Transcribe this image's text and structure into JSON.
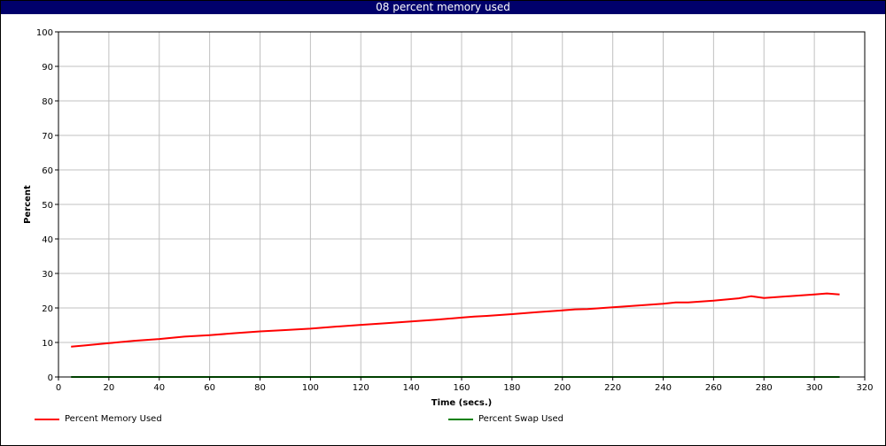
{
  "window": {
    "title": "08 percent memory used"
  },
  "chart_data": {
    "type": "line",
    "title": "08 percent memory used",
    "xlabel": "Time (secs.)",
    "ylabel": "Percent",
    "xlim": [
      0,
      320
    ],
    "ylim": [
      0,
      100
    ],
    "xticks": [
      0,
      20,
      40,
      60,
      80,
      100,
      120,
      140,
      160,
      180,
      200,
      220,
      240,
      260,
      280,
      300,
      320
    ],
    "yticks": [
      0,
      10,
      20,
      30,
      40,
      50,
      60,
      70,
      80,
      90,
      100
    ],
    "grid": true,
    "legend_position": "bottom",
    "series": [
      {
        "name": "Percent Memory Used",
        "color": "#ff0000",
        "x": [
          5,
          10,
          20,
          30,
          40,
          50,
          60,
          70,
          80,
          90,
          100,
          110,
          120,
          130,
          140,
          150,
          160,
          165,
          170,
          180,
          190,
          200,
          205,
          210,
          220,
          230,
          240,
          245,
          250,
          260,
          270,
          275,
          280,
          290,
          300,
          305,
          310
        ],
        "y": [
          8.8,
          9.1,
          9.8,
          10.5,
          11.0,
          11.7,
          12.1,
          12.7,
          13.2,
          13.6,
          14.0,
          14.6,
          15.1,
          15.6,
          16.1,
          16.6,
          17.2,
          17.5,
          17.7,
          18.2,
          18.8,
          19.3,
          19.6,
          19.7,
          20.2,
          20.7,
          21.2,
          21.6,
          21.6,
          22.1,
          22.8,
          23.4,
          22.9,
          23.4,
          23.9,
          24.2,
          23.9
        ]
      },
      {
        "name": "Percent Swap Used",
        "color": "#008000",
        "x": [
          5,
          310
        ],
        "y": [
          0,
          0
        ]
      }
    ]
  }
}
